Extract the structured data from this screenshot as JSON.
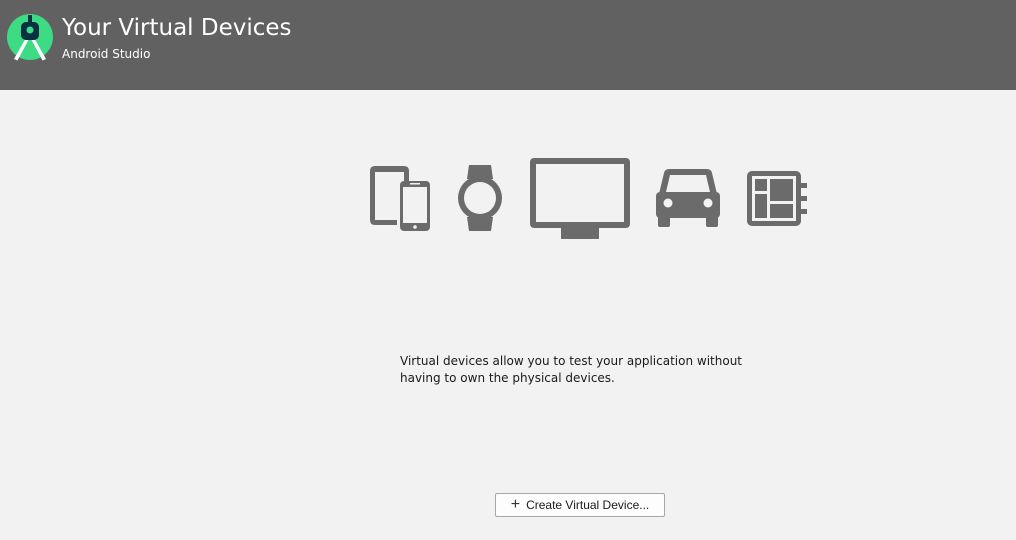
{
  "header": {
    "title": "Your Virtual Devices",
    "subtitle": "Android Studio",
    "background": "#616161",
    "logo_icon": "android-studio-logo-icon",
    "logo_color": "#3ddc84"
  },
  "main": {
    "device_icons": [
      "phone-tablet-icon",
      "wear-watch-icon",
      "tv-icon",
      "car-icon",
      "things-board-icon"
    ],
    "icon_color": "#6b6b6b",
    "description": "Virtual devices allow you to test your application without having to own the physical devices.",
    "create_button": {
      "icon": "plus-icon",
      "plus_glyph": "+",
      "label": "Create Virtual Device..."
    }
  }
}
